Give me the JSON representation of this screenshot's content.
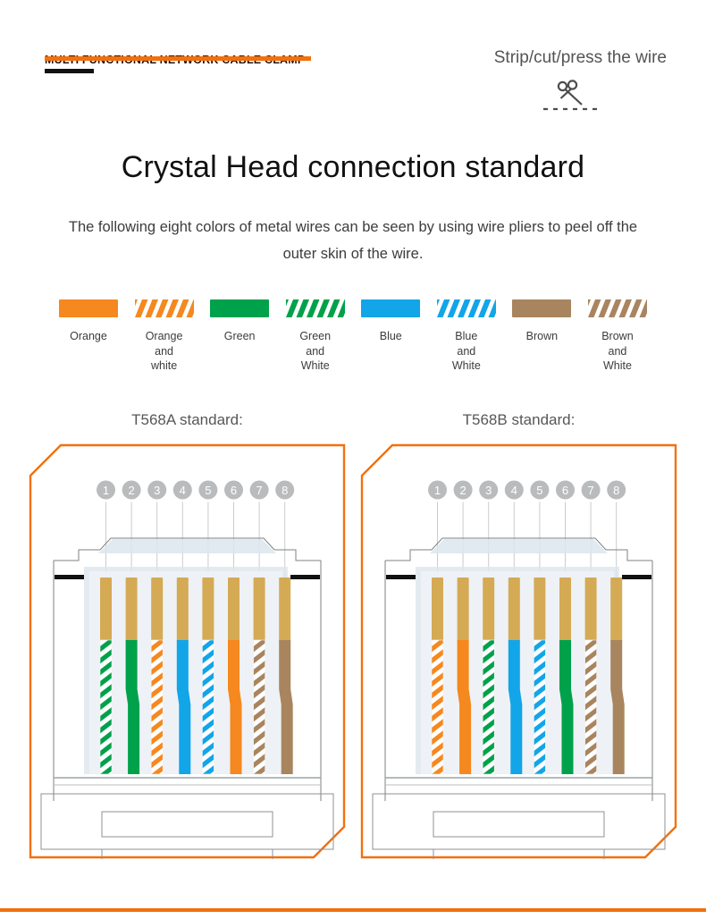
{
  "header": {
    "brand": "MULTI FUNCTIONAL NETWORK CABLE CLAMP",
    "right_text": "Strip/cut/press the wire",
    "scissors_icon": "scissors-icon"
  },
  "page_title": "Crystal Head connection standard",
  "subtitle": "The following eight colors of metal wires can be seen by using wire pliers to peel off the outer skin of the wire.",
  "colors": {
    "orange": "#F5881F",
    "green": "#00A14B",
    "blue": "#12A5E8",
    "brown": "#A8855F",
    "accent": "#F2700D",
    "gold": "#D2A447",
    "body_fill": "#DDE6EC",
    "pin_gray": "#B3B3B3"
  },
  "legend": {
    "items": [
      {
        "label": "Orange",
        "type": "solid",
        "color": "#F5881F"
      },
      {
        "label": "Orange\nand\nwhite",
        "type": "striped",
        "color": "#F5881F"
      },
      {
        "label": "Green",
        "type": "solid",
        "color": "#00A14B"
      },
      {
        "label": "Green\nand\nWhite",
        "type": "striped",
        "color": "#00A14B"
      },
      {
        "label": "Blue",
        "type": "solid",
        "color": "#12A5E8"
      },
      {
        "label": "Blue\nand\nWhite",
        "type": "striped",
        "color": "#12A5E8"
      },
      {
        "label": "Brown",
        "type": "solid",
        "color": "#A8855F"
      },
      {
        "label": "Brown\nand\nWhite",
        "type": "striped",
        "color": "#A8855F"
      }
    ]
  },
  "standards": [
    {
      "title": "T568A standard:",
      "pin_numbers": [
        "1",
        "2",
        "3",
        "4",
        "5",
        "6",
        "7",
        "8"
      ],
      "wires": [
        {
          "pin": "1",
          "name": "green-white",
          "color": "#00A14B",
          "type": "striped"
        },
        {
          "pin": "2",
          "name": "green",
          "color": "#00A14B",
          "type": "solid"
        },
        {
          "pin": "3",
          "name": "orange-white",
          "color": "#F5881F",
          "type": "striped"
        },
        {
          "pin": "4",
          "name": "blue",
          "color": "#12A5E8",
          "type": "solid"
        },
        {
          "pin": "5",
          "name": "blue-white",
          "color": "#12A5E8",
          "type": "striped"
        },
        {
          "pin": "6",
          "name": "orange",
          "color": "#F5881F",
          "type": "solid"
        },
        {
          "pin": "7",
          "name": "brown-white",
          "color": "#A8855F",
          "type": "striped"
        },
        {
          "pin": "8",
          "name": "brown",
          "color": "#A8855F",
          "type": "solid"
        }
      ]
    },
    {
      "title": "T568B standard:",
      "pin_numbers": [
        "1",
        "2",
        "3",
        "4",
        "5",
        "6",
        "7",
        "8"
      ],
      "wires": [
        {
          "pin": "1",
          "name": "orange-white",
          "color": "#F5881F",
          "type": "striped"
        },
        {
          "pin": "2",
          "name": "orange",
          "color": "#F5881F",
          "type": "solid"
        },
        {
          "pin": "3",
          "name": "green-white",
          "color": "#00A14B",
          "type": "striped"
        },
        {
          "pin": "4",
          "name": "blue",
          "color": "#12A5E8",
          "type": "solid"
        },
        {
          "pin": "5",
          "name": "blue-white",
          "color": "#12A5E8",
          "type": "striped"
        },
        {
          "pin": "6",
          "name": "green",
          "color": "#00A14B",
          "type": "solid"
        },
        {
          "pin": "7",
          "name": "brown-white",
          "color": "#A8855F",
          "type": "striped"
        },
        {
          "pin": "8",
          "name": "brown",
          "color": "#A8855F",
          "type": "solid"
        }
      ]
    }
  ]
}
